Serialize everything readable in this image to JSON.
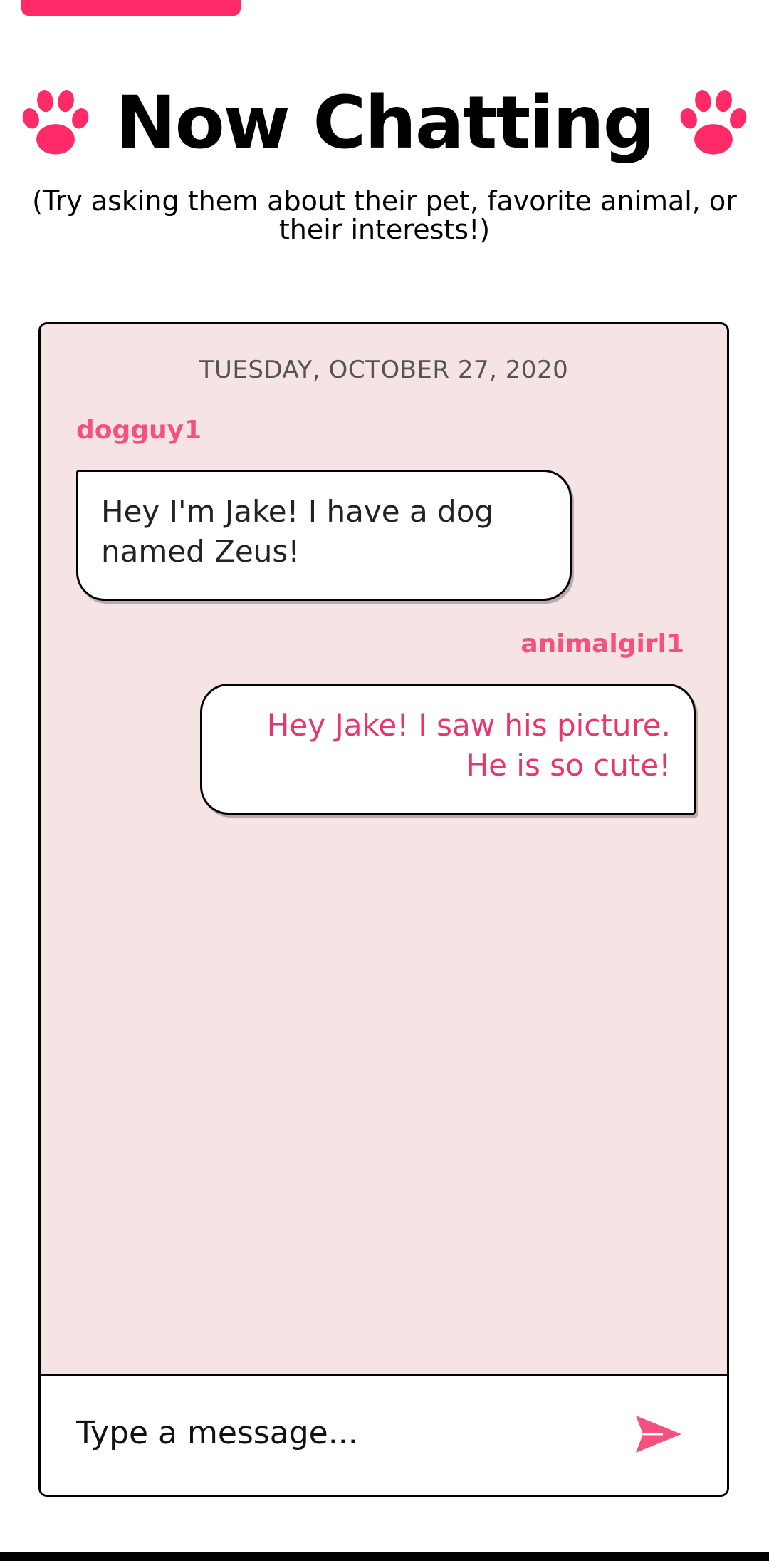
{
  "header": {
    "title": "Now Chatting",
    "subtitle": "(Try asking them about their pet, favorite animal, or their interests!)",
    "left_icon": "paw-icon",
    "right_icon": "paw-icon"
  },
  "chat": {
    "date": "TUESDAY, OCTOBER 27, 2020",
    "messages": [
      {
        "sender": "dogguy1",
        "text": "Hey I'm Jake! I have a dog named Zeus!",
        "direction": "incoming"
      },
      {
        "sender": "animalgirl1",
        "text": "Hey Jake! I saw his picture. He is so cute!",
        "direction": "outgoing"
      }
    ]
  },
  "composer": {
    "placeholder": "Type a message...",
    "send_icon": "send-icon"
  },
  "colors": {
    "accent": "#ff2a68",
    "username": "#f2527d",
    "panel_background": "#f6e4e5"
  }
}
